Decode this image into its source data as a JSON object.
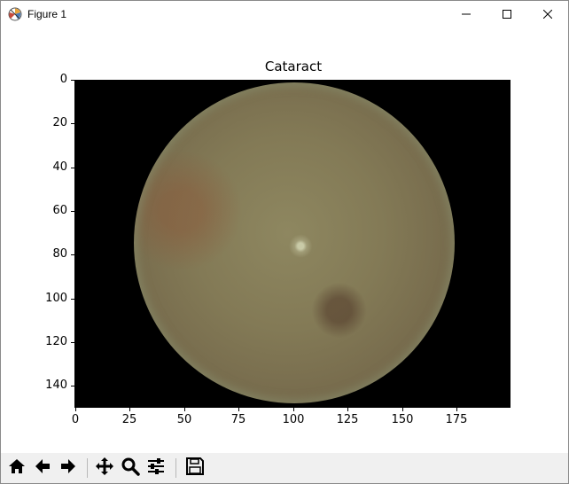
{
  "window": {
    "title": "Figure 1"
  },
  "icons": {
    "app": "matplotlib-figure-icon",
    "minimize": "minimize-icon",
    "maximize": "maximize-icon",
    "close": "close-icon"
  },
  "axes": {
    "title": "Cataract",
    "x_ticks": [
      "0",
      "25",
      "50",
      "75",
      "100",
      "125",
      "150",
      "175"
    ],
    "y_ticks": [
      "0",
      "20",
      "40",
      "60",
      "80",
      "100",
      "120",
      "140"
    ],
    "x_range": [
      0,
      200
    ],
    "y_range": [
      150,
      0
    ],
    "image": "retinal fundus photograph"
  },
  "toolbar": {
    "buttons": [
      {
        "name": "home-button",
        "icon": "home-icon"
      },
      {
        "name": "back-button",
        "icon": "arrow-left-icon"
      },
      {
        "name": "forward-button",
        "icon": "arrow-right-icon"
      },
      {
        "name": "pan-button",
        "icon": "move-icon"
      },
      {
        "name": "zoom-button",
        "icon": "magnifier-icon"
      },
      {
        "name": "configure-subplots-button",
        "icon": "sliders-icon"
      },
      {
        "name": "save-button",
        "icon": "floppy-disk-icon"
      }
    ]
  },
  "colors": {
    "toolbar_bg": "#f0f0f0",
    "plot_bg": "#000000",
    "fundus_base": "#837a56"
  }
}
